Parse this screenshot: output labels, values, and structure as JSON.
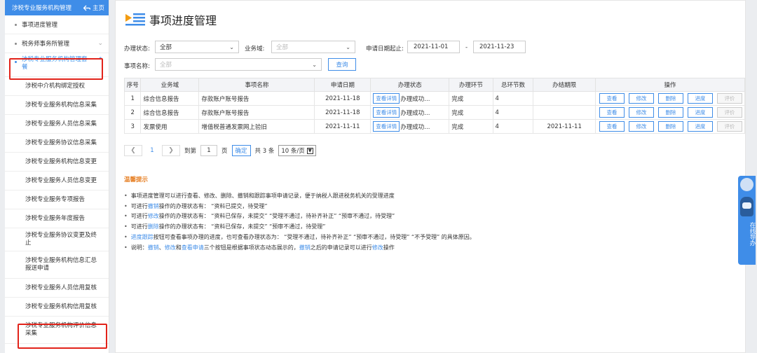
{
  "sidebar": {
    "header_title": "涉税专业服务机构管理",
    "home_label": "主页",
    "items": [
      {
        "label": "事项进度管理"
      },
      {
        "label": "税务师事务所管理"
      },
      {
        "label": "涉税专业服务机构管理套餐"
      }
    ],
    "subitems": [
      {
        "label": "涉税中介机构绑定授权"
      },
      {
        "label": "涉税专业服务机构信息采集"
      },
      {
        "label": "涉税专业服务人员信息采集"
      },
      {
        "label": "涉税专业服务协议信息采集"
      },
      {
        "label": "涉税专业服务机构信息变更"
      },
      {
        "label": "涉税专业服务人员信息变更"
      },
      {
        "label": "涉税专业服务专项报告"
      },
      {
        "label": "涉税专业服务年度报告"
      },
      {
        "label": "涉税专业服务协议变更及终止"
      },
      {
        "label": "涉税专业服务机构信息汇总报送申请"
      },
      {
        "label": "涉税专业服务人员信用复核"
      },
      {
        "label": "涉税专业服务机构信用复核"
      },
      {
        "label": "涉税专业服务机构评价信息采集"
      }
    ]
  },
  "page": {
    "title": "事项进度管理",
    "title_icon": "list-icon",
    "accent_color": "#3f8de8",
    "highlight_color": "#e2231a"
  },
  "filters": {
    "status_label": "办理状态:",
    "status_value": "全部",
    "domain_label": "业务域:",
    "domain_placeholder": "全部",
    "date_label": "申请日期起止:",
    "date_from": "2021-11-01",
    "date_sep": "-",
    "date_to": "2021-11-23",
    "item_label": "事项名称:",
    "item_placeholder": "全部",
    "query_button": "查询"
  },
  "table": {
    "headers": [
      "序号",
      "业务域",
      "事项名称",
      "申请日期",
      "办理状态",
      "办理环节",
      "总环节数",
      "办结期限",
      "操作"
    ],
    "detail_button": "查看详情",
    "op_buttons": [
      "查看",
      "修改",
      "删除",
      "进度",
      "评价"
    ],
    "rows": [
      {
        "no": "1",
        "domain": "综合信息报告",
        "name": "存款账户账号报告",
        "date": "2021-11-18",
        "status": "办理成功...",
        "step": "完成",
        "total": "4",
        "deadline": ""
      },
      {
        "no": "2",
        "domain": "综合信息报告",
        "name": "存款账户账号报告",
        "date": "2021-11-18",
        "status": "办理成功...",
        "step": "完成",
        "total": "4",
        "deadline": ""
      },
      {
        "no": "3",
        "domain": "发票使用",
        "name": "增值税普通发票网上验旧",
        "date": "2021-11-11",
        "status": "办理成功...",
        "step": "完成",
        "total": "4",
        "deadline": "2021-11-11"
      }
    ]
  },
  "pager": {
    "prev_icon": "chevron-left-icon",
    "current_page": "1",
    "next_icon": "chevron-right-icon",
    "goto_label": "到第",
    "goto_value": "1",
    "page_unit": "页",
    "confirm_label": "确定",
    "total_label": "共 3 条",
    "page_size": "10 条/页"
  },
  "tips": {
    "title": "温馨提示",
    "lines": [
      [
        {
          "t": "事项进度管理可以进行查看、修改、删除、撤销和跟踪事项申请记录，便于纳税人跟进税务机关的受理进度"
        }
      ],
      [
        {
          "t": "可进行"
        },
        {
          "t": "撤销",
          "k": true
        },
        {
          "t": "操作的办理状态有：  “资料已提交，待受理”"
        }
      ],
      [
        {
          "t": "可进行"
        },
        {
          "t": "修改",
          "k": true
        },
        {
          "t": "操作的办理状态有：  “资料已保存，未提交”   “受理不通过，待补齐补正”   “预审不通过，待受理”"
        }
      ],
      [
        {
          "t": "可进行"
        },
        {
          "t": "删除",
          "k": true
        },
        {
          "t": "操作的办理状态有：  “资料已保存，未提交”   “预审不通过，待受理”"
        }
      ],
      [
        {
          "t": "进度跟踪",
          "k": true
        },
        {
          "t": "按钮可查看事项办理的进度，也可查看办理状态为：  “受理不通过，待补齐补正”   “预审不通过，待受理”   “不予受理”  的具体原因。"
        }
      ],
      [
        {
          "t": "说明："
        },
        {
          "t": "撤销",
          "k": true
        },
        {
          "t": "、"
        },
        {
          "t": "修改",
          "k": true
        },
        {
          "t": "和"
        },
        {
          "t": "查看申请",
          "k": true
        },
        {
          "t": "三个按钮是根据事项状态动态展示的，"
        },
        {
          "t": "撤销",
          "k": true
        },
        {
          "t": "之后的申请记录可以进行"
        },
        {
          "t": "修改",
          "k": true
        },
        {
          "t": "操作"
        }
      ]
    ]
  },
  "float_helper": {
    "label": "在线导办",
    "icons": [
      "user-avatar-icon",
      "robot-icon"
    ]
  }
}
